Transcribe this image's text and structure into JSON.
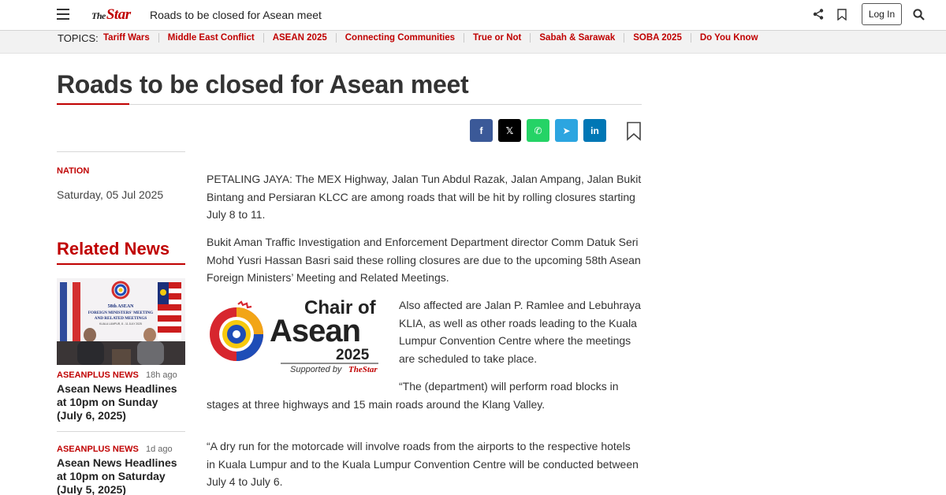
{
  "header": {
    "logo_prefix": "The",
    "logo_text": "Star",
    "title": "Roads to be closed for Asean meet",
    "login_label": "Log In",
    "icons": [
      "menu-icon",
      "share-icon",
      "bookmark-icon",
      "search-icon"
    ]
  },
  "topics": {
    "label": "TOPICS:",
    "items": [
      {
        "label": "Tariff Wars"
      },
      {
        "label": "Middle East Conflict"
      },
      {
        "label": "ASEAN 2025"
      },
      {
        "label": "Connecting Communities"
      },
      {
        "label": "True or Not"
      },
      {
        "label": "Sabah & Sarawak"
      },
      {
        "label": "SOBA 2025"
      },
      {
        "label": "Do You Know"
      }
    ]
  },
  "article": {
    "headline": "Roads to be closed for Asean meet",
    "category": "NATION",
    "date": "Saturday, 05 Jul 2025",
    "share_buttons": [
      {
        "name": "facebook",
        "glyph": "f"
      },
      {
        "name": "x",
        "glyph": "𝕏"
      },
      {
        "name": "whatsapp",
        "glyph": "✆"
      },
      {
        "name": "telegram",
        "glyph": "➤"
      },
      {
        "name": "linkedin",
        "glyph": "in"
      }
    ],
    "paragraphs": [
      "PETALING JAYA: The MEX Highway, Jalan Tun Abdul Razak, Jalan Ampang, Jalan Bukit Bintang and Persiaran KLCC are among roads that will be hit by rolling closures starting July 8 to 11.",
      "Bukit Aman Traffic Investigation and Enforcement Department director Comm Datuk Seri Mohd Yusri Hassan Basri said these rolling closures are due to the upcoming 58th Asean Foreign Ministers’ Meeting and Related Meetings.",
      "Also affected are Jalan P. Ramlee and Lebuhraya KLIA, as well as other roads leading to the Kuala Lumpur Convention Centre where the meetings are scheduled to take place.",
      "“The (department) will perform road blocks in stages at three highways and 15 main roads around the Klang Valley.",
      "“A dry run for the motorcade will involve roads from the airports to the respective hotels in Kuala Lumpur and to the Kuala Lumpur Convention Centre will be conducted between July 4 to July 6."
    ],
    "inline_logo": {
      "line1": "Chair of",
      "line2": "Asean",
      "line3": "2025",
      "supported_by": "Supported by",
      "supporter": "TheStar"
    }
  },
  "related": {
    "heading": "Related News",
    "thumb_banner": [
      "58th ASEAN",
      "FOREIGN MINISTERS' MEETING",
      "AND RELATED MEETINGS",
      "KUALA LUMPUR, 8 - 11 JULY 2025"
    ],
    "items": [
      {
        "category": "ASEANPLUS NEWS",
        "time": "18h ago",
        "title": "Asean News Headlines at 10pm on Sunday (July 6, 2025)"
      },
      {
        "category": "ASEANPLUS NEWS",
        "time": "1d ago",
        "title": "Asean News Headlines at 10pm on Saturday (July 5, 2025)"
      }
    ]
  },
  "colors": {
    "brand_red": "#c00000",
    "facebook": "#3b5998",
    "whatsapp": "#25d366",
    "telegram": "#2ca5e0",
    "linkedin": "#0077b5"
  }
}
